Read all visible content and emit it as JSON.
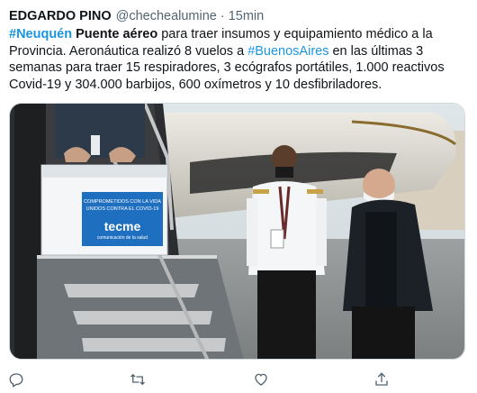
{
  "tweet": {
    "author": {
      "name": "EDGARDO PINO",
      "handle": "@chechealumine",
      "separator": "·",
      "time": "15min"
    },
    "text": {
      "hashtag_1": "#Neuquén",
      "bold_title": "Puente aéreo",
      "part_1": " para traer insumos y equipamiento médico a la Provincia. Aeronáutica realizó 8 vuelos a ",
      "hashtag_2": "#BuenosAires",
      "part_2": " en las últimas 3 semanas para traer 15 respiradores, 3 ecógrafos portátiles, 1.000 reactivos Covid-19 y 304.000 barbijos, 600 oxímetros y 10 desfibriladores."
    },
    "photo": {
      "box_banner": "COMPROMETIDOS CON LA VIDA",
      "box_banner_2": "UNIDOS CONTRA EL COVID-19",
      "box_brand": "tecme",
      "box_tagline": "comunicación de la salud"
    },
    "actions": {
      "reply_icon": "reply-icon",
      "retweet_icon": "retweet-icon",
      "like_icon": "heart-icon",
      "share_icon": "share-icon"
    },
    "colors": {
      "text": "#0f1419",
      "secondary": "#536471",
      "link": "#1b95e0",
      "icon": "#536471"
    }
  }
}
